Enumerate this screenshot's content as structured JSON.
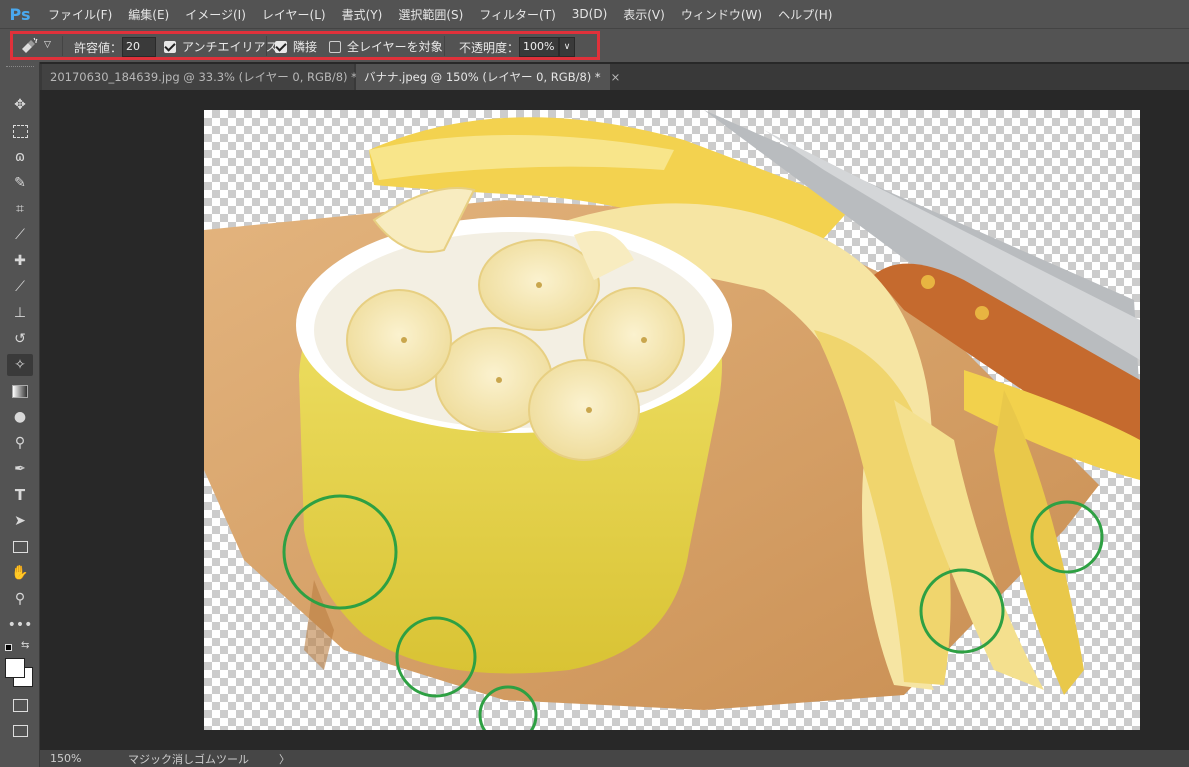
{
  "app": {
    "logo": "Ps"
  },
  "menu": [
    "ファイル(F)",
    "編集(E)",
    "イメージ(I)",
    "レイヤー(L)",
    "書式(Y)",
    "選択範囲(S)",
    "フィルター(T)",
    "3D(D)",
    "表示(V)",
    "ウィンドウ(W)",
    "ヘルプ(H)"
  ],
  "options": {
    "tolerance_label": "許容値：",
    "tolerance_value": "20",
    "antialias_label": "アンチエイリアス",
    "antialias_checked": true,
    "contiguous_label": "隣接",
    "contiguous_checked": true,
    "all_layers_label": "全レイヤーを対象",
    "all_layers_checked": false,
    "opacity_label": "不透明度：",
    "opacity_value": "100%"
  },
  "tabs": [
    {
      "label": "20170630_184639.jpg @ 33.3% (レイヤー 0, RGB/8) *",
      "close": "×",
      "active": false
    },
    {
      "label": "バナナ.jpeg @ 150% (レイヤー 0, RGB/8) *",
      "close": "×",
      "active": true
    }
  ],
  "tools": [
    "move-icon",
    "marquee-icon",
    "lasso-icon",
    "quick-select-icon",
    "crop-icon",
    "eyedropper-icon",
    "healing-icon",
    "brush-icon",
    "stamp-icon",
    "history-brush-icon",
    "magic-eraser-icon",
    "gradient-icon",
    "blur-icon",
    "dodge-icon",
    "pen-icon",
    "type-icon",
    "path-select-icon",
    "rectangle-icon",
    "hand-icon",
    "zoom-icon",
    "more-icon"
  ],
  "status": {
    "zoom": "150%",
    "info": "マジック消しゴムツール",
    "arrow": "〉"
  },
  "colors": {
    "highlight": "#e0313a",
    "circle": "#2ea043"
  }
}
